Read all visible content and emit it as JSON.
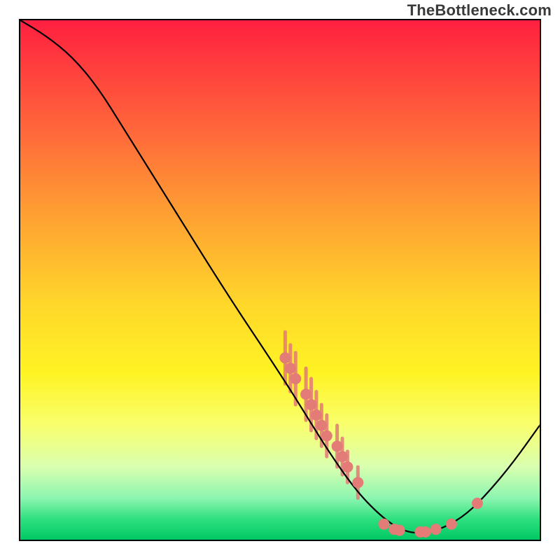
{
  "watermark_text": "TheBottleneck.com",
  "chart_data": {
    "type": "line",
    "title": "",
    "xlabel": "",
    "ylabel": "",
    "xlim": [
      0,
      100
    ],
    "ylim": [
      0,
      100
    ],
    "curve": [
      {
        "x": 0,
        "y": 100
      },
      {
        "x": 5,
        "y": 97
      },
      {
        "x": 10,
        "y": 93
      },
      {
        "x": 15,
        "y": 87
      },
      {
        "x": 20,
        "y": 79
      },
      {
        "x": 30,
        "y": 63
      },
      {
        "x": 40,
        "y": 47
      },
      {
        "x": 50,
        "y": 32
      },
      {
        "x": 55,
        "y": 24
      },
      {
        "x": 60,
        "y": 16
      },
      {
        "x": 65,
        "y": 9
      },
      {
        "x": 70,
        "y": 4
      },
      {
        "x": 74,
        "y": 1.5
      },
      {
        "x": 78,
        "y": 1.2
      },
      {
        "x": 82,
        "y": 2.5
      },
      {
        "x": 86,
        "y": 5
      },
      {
        "x": 90,
        "y": 9
      },
      {
        "x": 95,
        "y": 15
      },
      {
        "x": 100,
        "y": 22
      }
    ],
    "scatter_points": [
      {
        "x": 51,
        "y": 35,
        "err": 5
      },
      {
        "x": 52,
        "y": 33,
        "err": 4.5
      },
      {
        "x": 53,
        "y": 31,
        "err": 5
      },
      {
        "x": 55,
        "y": 28,
        "err": 5
      },
      {
        "x": 56,
        "y": 26,
        "err": 5
      },
      {
        "x": 57,
        "y": 24,
        "err": 4.5
      },
      {
        "x": 58,
        "y": 22,
        "err": 4
      },
      {
        "x": 59,
        "y": 20,
        "err": 4
      },
      {
        "x": 61,
        "y": 18,
        "err": 4
      },
      {
        "x": 62,
        "y": 16,
        "err": 3.5
      },
      {
        "x": 63,
        "y": 14,
        "err": 3
      },
      {
        "x": 65,
        "y": 11,
        "err": 3
      },
      {
        "x": 70,
        "y": 3,
        "err": 0
      },
      {
        "x": 72,
        "y": 2,
        "err": 0
      },
      {
        "x": 73,
        "y": 1.8,
        "err": 0
      },
      {
        "x": 77,
        "y": 1.5,
        "err": 0
      },
      {
        "x": 78,
        "y": 1.5,
        "err": 0
      },
      {
        "x": 80,
        "y": 2,
        "err": 0
      },
      {
        "x": 83,
        "y": 3,
        "err": 0
      },
      {
        "x": 88,
        "y": 7,
        "err": 0
      }
    ],
    "colors": {
      "curve": "#000000",
      "points": "#e37b77",
      "gradient_top": "#ff1f3f",
      "gradient_bottom": "#00c864"
    }
  }
}
